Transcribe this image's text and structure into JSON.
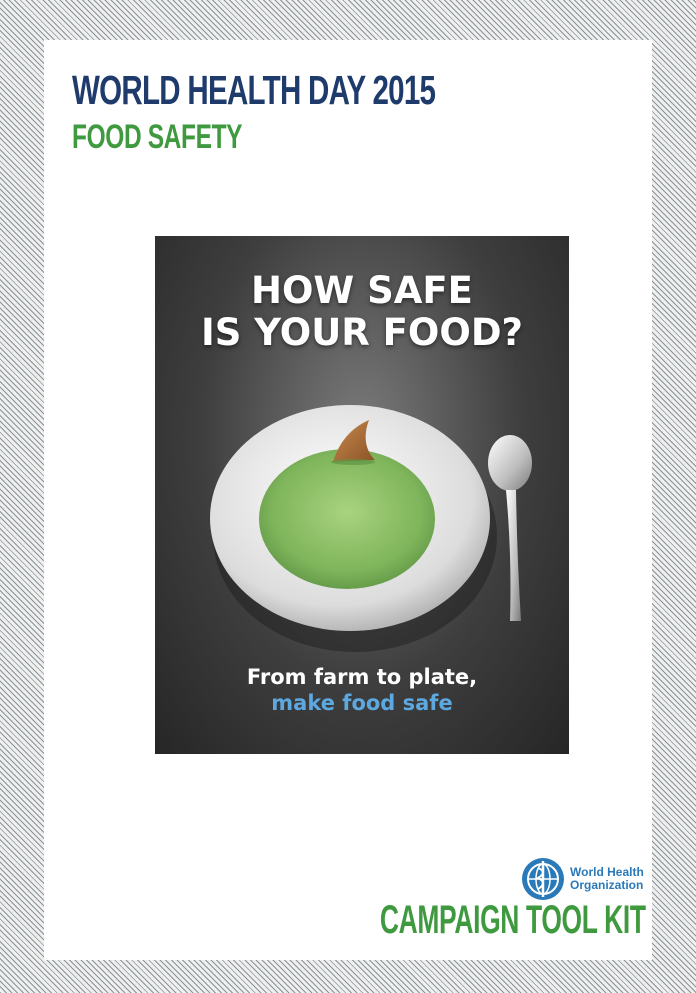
{
  "colors": {
    "title_navy": "#1f3b6c",
    "accent_green": "#3f9a3f",
    "tagline_blue": "#5ea8e0",
    "who_blue": "#2a79b9",
    "soup_green": "#8cbf6a",
    "frame_hatch": "#8c9296"
  },
  "header": {
    "title": "WORLD HEALTH DAY 2015",
    "subtitle": "FOOD SAFETY"
  },
  "poster": {
    "headline_line1": "HOW SAFE",
    "headline_line2": "IS YOUR FOOD?",
    "tagline_line1": "From farm to plate,",
    "tagline_line2": "make food safe"
  },
  "who": {
    "name_line1": "World Health",
    "name_line2": "Organization",
    "emblem_icon": "who-emblem-icon"
  },
  "footer": {
    "label": "CAMPAIGN TOOL KIT"
  }
}
